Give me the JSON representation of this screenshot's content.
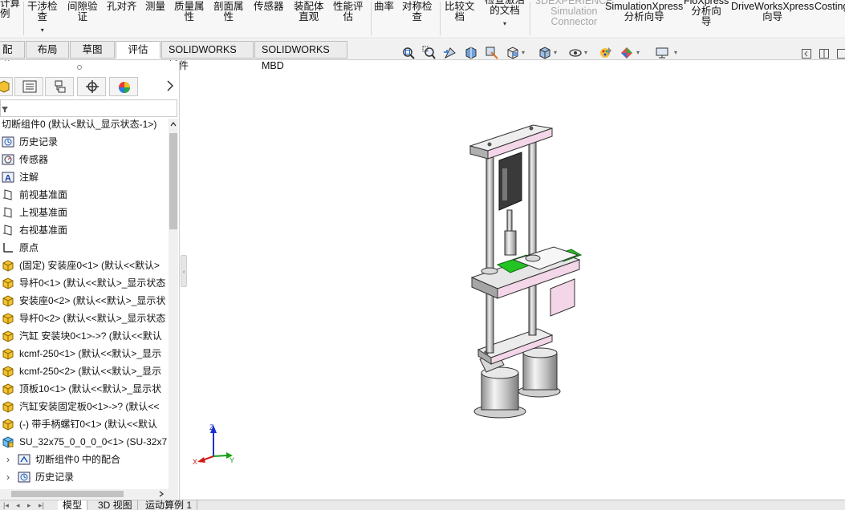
{
  "ribbon": {
    "items": [
      {
        "label": "干涉检\n查",
        "dropdown": true
      },
      {
        "label": "间隙验\n证",
        "dropdown": false
      },
      {
        "label": "孔对齐",
        "dropdown": false
      },
      {
        "label": "测量",
        "dropdown": false
      },
      {
        "label": "质量属\n性",
        "dropdown": false
      },
      {
        "label": "剖面属\n性",
        "dropdown": false
      },
      {
        "label": "传感器",
        "dropdown": false
      },
      {
        "label": "装配体\n直观",
        "dropdown": false
      },
      {
        "label": "性能评\n估",
        "dropdown": false
      },
      {
        "label": "曲率",
        "dropdown": false
      },
      {
        "label": "对称检\n查",
        "dropdown": false
      },
      {
        "label": "比较文\n档",
        "dropdown": false
      },
      {
        "label": "检查激活\n的文档",
        "dropdown": true
      },
      {
        "label": "3DEXPERIENCE\nSimulation\nConnector",
        "dropdown": false,
        "disabled": true
      },
      {
        "label": "SimulationXpress\n分析向导",
        "dropdown": false
      },
      {
        "label": "FloXpress\n分析向\n导",
        "dropdown": false
      },
      {
        "label": "DriveWorksXpress\n向导",
        "dropdown": false
      },
      {
        "label": "Costing",
        "dropdown": false
      }
    ],
    "cut_first": "计算\n例"
  },
  "command_tabs": [
    "配体",
    "布局",
    "草图",
    "评估",
    "SOLIDWORKS 插件",
    "SOLIDWORKS MBD"
  ],
  "active_tab": "评估",
  "left_panel": {
    "filter_placeholder": "",
    "tree": [
      {
        "label": "切断组件0 (默认<默认_显示状态-1>)",
        "icon": "assembly-icon",
        "indent": 0
      },
      {
        "label": "历史记录",
        "icon": "history-icon",
        "indent": 0
      },
      {
        "label": "传感器",
        "icon": "sensor-icon",
        "indent": 0
      },
      {
        "label": "注解",
        "icon": "annotation-icon",
        "indent": 0
      },
      {
        "label": "前视基准面",
        "icon": "plane-icon",
        "indent": 0
      },
      {
        "label": "上视基准面",
        "icon": "plane-icon",
        "indent": 0
      },
      {
        "label": "右视基准面",
        "icon": "plane-icon",
        "indent": 0
      },
      {
        "label": "原点",
        "icon": "origin-icon",
        "indent": 0
      },
      {
        "label": "(固定) 安装座0<1> (默认<<默认>",
        "icon": "part-icon",
        "indent": 0
      },
      {
        "label": "导杆0<1> (默认<<默认>_显示状态",
        "icon": "part-icon",
        "indent": 0
      },
      {
        "label": "安装座0<2> (默认<<默认>_显示状",
        "icon": "part-icon",
        "indent": 0
      },
      {
        "label": "导杆0<2> (默认<<默认>_显示状态",
        "icon": "part-icon",
        "indent": 0
      },
      {
        "label": "汽缸 安装块0<1>->? (默认<<默认",
        "icon": "part-icon",
        "indent": 0
      },
      {
        "label": "kcmf-250<1> (默认<<默认>_显示",
        "icon": "part-icon",
        "indent": 0
      },
      {
        "label": "kcmf-250<2> (默认<<默认>_显示",
        "icon": "part-icon",
        "indent": 0
      },
      {
        "label": "顶板10<1> (默认<<默认>_显示状",
        "icon": "part-icon",
        "indent": 0
      },
      {
        "label": "汽缸安装固定板0<1>->? (默认<<",
        "icon": "part-icon",
        "indent": 0
      },
      {
        "label": "(-) 带手柄螺钉0<1> (默认<<默认",
        "icon": "part-icon",
        "indent": 0
      },
      {
        "label": "SU_32x75_0_0_0_0<1> (SU-32x7",
        "icon": "subassembly-icon",
        "indent": 0
      },
      {
        "label": "切断组件0 中的配合",
        "icon": "mates-icon",
        "indent": 1
      },
      {
        "label": "历史记录",
        "icon": "history-icon",
        "indent": 1
      }
    ]
  },
  "bottom_tabs": [
    "模型",
    "3D 视图",
    "运动算例 1"
  ],
  "active_bottom_tab": "模型",
  "triad": {
    "x": "X",
    "y": "Y",
    "z": "Z"
  },
  "colors": {
    "accent_green": "#22c322",
    "pink": "#f3d6e8",
    "axis_x": "#d01818",
    "axis_y": "#18a018",
    "axis_z": "#1830d0"
  }
}
